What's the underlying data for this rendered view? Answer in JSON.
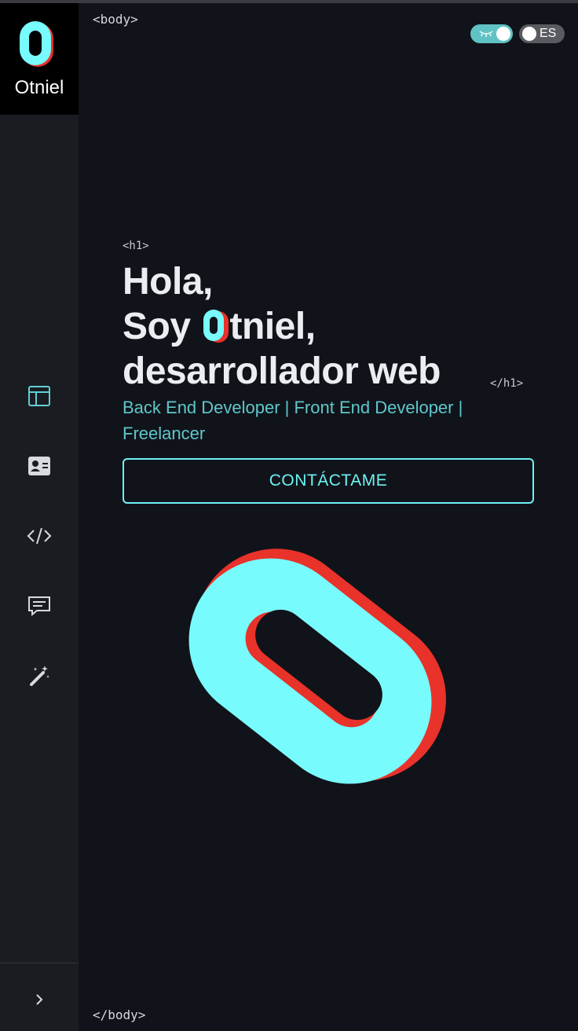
{
  "brand": {
    "name": "Otniel",
    "logo_letter": "O"
  },
  "sidebar": {
    "items": [
      {
        "name": "home",
        "icon": "layout-icon"
      },
      {
        "name": "about",
        "icon": "contact-card-icon"
      },
      {
        "name": "projects",
        "icon": "code-icon"
      },
      {
        "name": "contact",
        "icon": "message-icon"
      },
      {
        "name": "skills",
        "icon": "magic-wand-icon"
      }
    ],
    "expand_icon": "chevron-right-icon"
  },
  "tags": {
    "body_open": "<body>",
    "body_close": "</body>",
    "h1_open": "<h1>",
    "h1_close": "</h1>"
  },
  "toggles": {
    "theme": {
      "state": "on",
      "icon": "closed-eye-icon"
    },
    "language": {
      "label": "ES"
    }
  },
  "hero": {
    "line1": "Hola,",
    "line2_before": "Soy",
    "line2_after": "tniel,",
    "line3": "desarrollador web",
    "subtitle": "Back End Developer | Front End Developer | Freelancer",
    "cta_label": "CONTÁCTAME"
  },
  "colors": {
    "background": "#11131a",
    "sidebar": "#1a1c22",
    "accent_cyan": "#78fbfd",
    "accent_red": "#e8322a",
    "subtitle": "#5ec8cb",
    "title": "#ebedf1"
  }
}
